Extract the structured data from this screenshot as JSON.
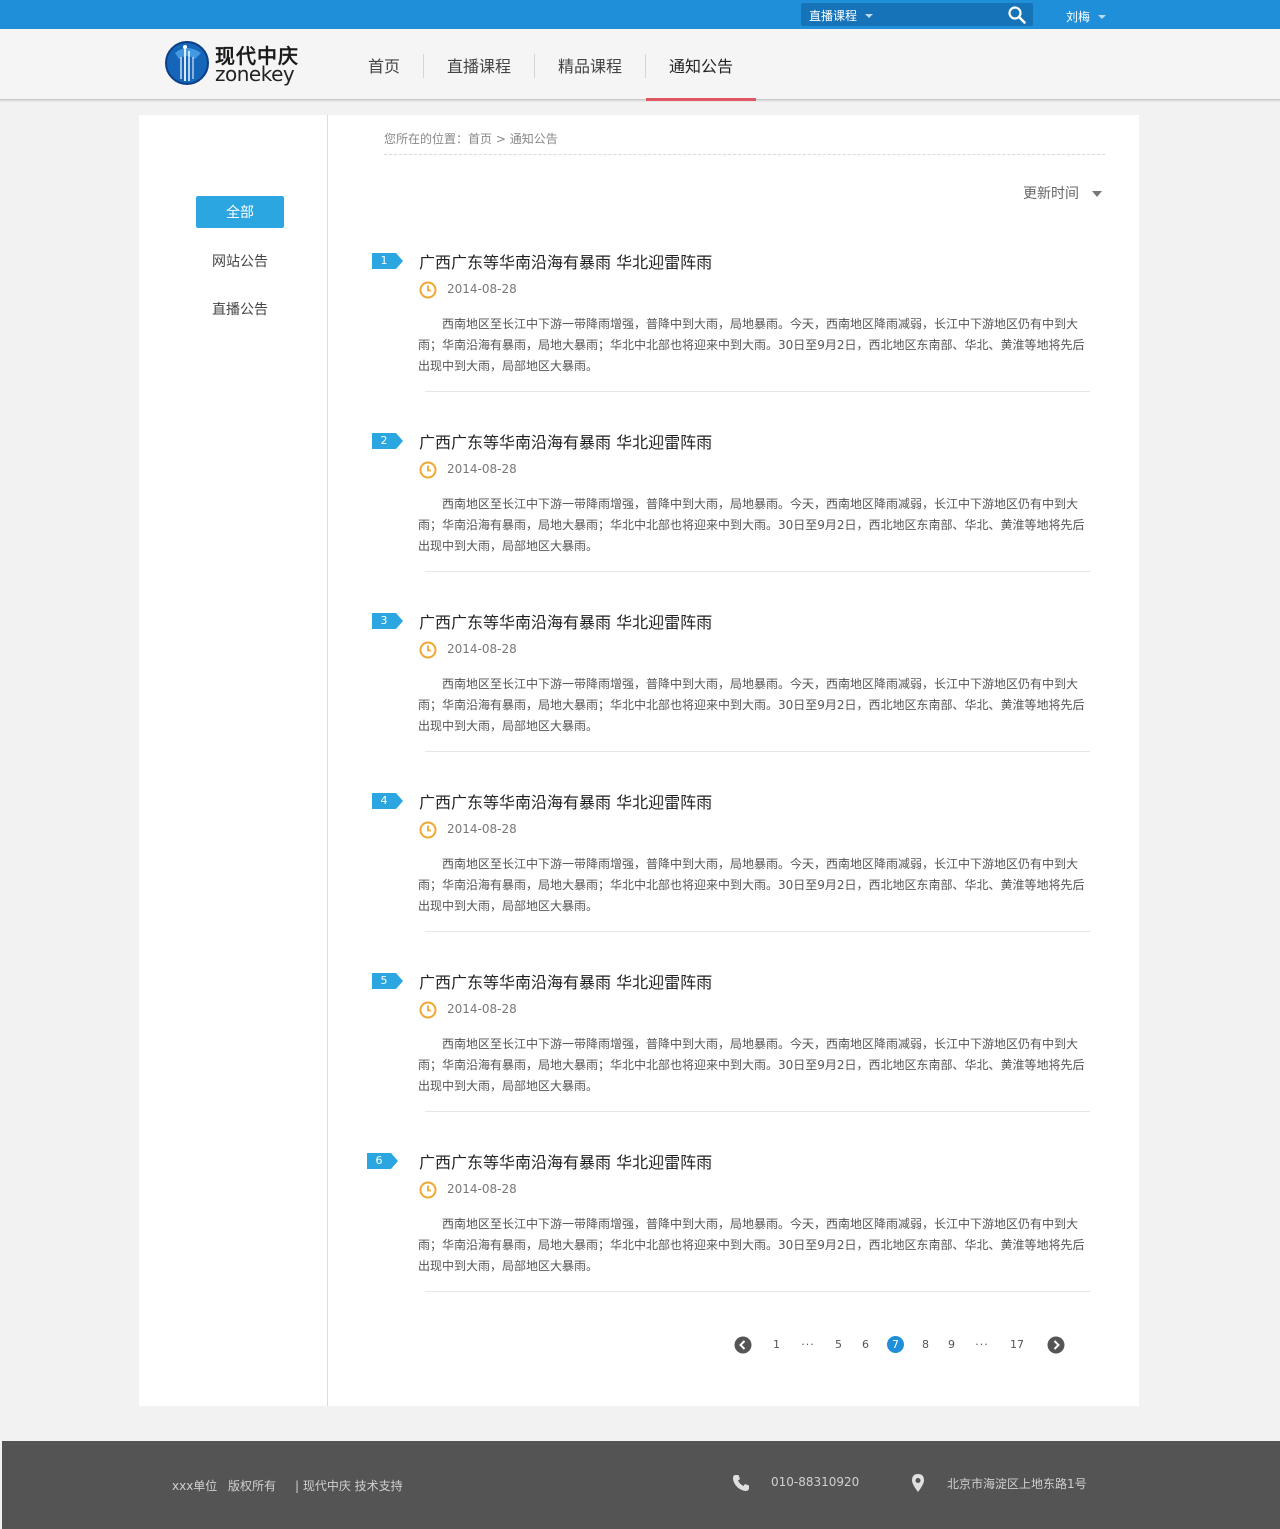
{
  "topbar": {
    "search_type": "直播课程",
    "search_placeholder": "",
    "user_name": "刘梅"
  },
  "logo": {
    "cn": "现代中庆",
    "en": "zonekey"
  },
  "nav": {
    "items": [
      {
        "label": "首页",
        "active": false
      },
      {
        "label": "直播课程",
        "active": false
      },
      {
        "label": "精品课程",
        "active": false
      },
      {
        "label": "通知公告",
        "active": true
      }
    ]
  },
  "sidebar": {
    "items": [
      {
        "label": "全部",
        "active": true
      },
      {
        "label": "网站公告",
        "active": false
      },
      {
        "label": "直播公告",
        "active": false
      }
    ]
  },
  "breadcrumb": {
    "prefix": "您所在的位置：",
    "home": "首页",
    "sep": " > ",
    "current": "通知公告"
  },
  "sort": {
    "label": "更新时间"
  },
  "notices": [
    {
      "num": "1",
      "title": "广西广东等华南沿海有暴雨 华北迎雷阵雨",
      "date": "2014-08-28",
      "body": "西南地区至长江中下游一带降雨增强，普降中到大雨，局地暴雨。今天，西南地区降雨减弱，长江中下游地区仍有中到大雨；华南沿海有暴雨，局地大暴雨；华北中北部也将迎来中到大雨。30日至9月2日，西北地区东南部、华北、黄淮等地将先后出现中到大雨，局部地区大暴雨。"
    },
    {
      "num": "2",
      "title": "广西广东等华南沿海有暴雨 华北迎雷阵雨",
      "date": "2014-08-28",
      "body": "西南地区至长江中下游一带降雨增强，普降中到大雨，局地暴雨。今天，西南地区降雨减弱，长江中下游地区仍有中到大雨；华南沿海有暴雨，局地大暴雨；华北中北部也将迎来中到大雨。30日至9月2日，西北地区东南部、华北、黄淮等地将先后出现中到大雨，局部地区大暴雨。"
    },
    {
      "num": "3",
      "title": "广西广东等华南沿海有暴雨 华北迎雷阵雨",
      "date": "2014-08-28",
      "body": "西南地区至长江中下游一带降雨增强，普降中到大雨，局地暴雨。今天，西南地区降雨减弱，长江中下游地区仍有中到大雨；华南沿海有暴雨，局地大暴雨；华北中北部也将迎来中到大雨。30日至9月2日，西北地区东南部、华北、黄淮等地将先后出现中到大雨，局部地区大暴雨。"
    },
    {
      "num": "4",
      "title": "广西广东等华南沿海有暴雨 华北迎雷阵雨",
      "date": "2014-08-28",
      "body": "西南地区至长江中下游一带降雨增强，普降中到大雨，局地暴雨。今天，西南地区降雨减弱，长江中下游地区仍有中到大雨；华南沿海有暴雨，局地大暴雨；华北中北部也将迎来中到大雨。30日至9月2日，西北地区东南部、华北、黄淮等地将先后出现中到大雨，局部地区大暴雨。"
    },
    {
      "num": "5",
      "title": "广西广东等华南沿海有暴雨 华北迎雷阵雨",
      "date": "2014-08-28",
      "body": "西南地区至长江中下游一带降雨增强，普降中到大雨，局地暴雨。今天，西南地区降雨减弱，长江中下游地区仍有中到大雨；华南沿海有暴雨，局地大暴雨；华北中北部也将迎来中到大雨。30日至9月2日，西北地区东南部、华北、黄淮等地将先后出现中到大雨，局部地区大暴雨。"
    },
    {
      "num": "6",
      "title": "广西广东等华南沿海有暴雨 华北迎雷阵雨",
      "date": "2014-08-28",
      "body": "西南地区至长江中下游一带降雨增强，普降中到大雨，局地暴雨。今天，西南地区降雨减弱，长江中下游地区仍有中到大雨；华南沿海有暴雨，局地大暴雨；华北中北部也将迎来中到大雨。30日至9月2日，西北地区东南部、华北、黄淮等地将先后出现中到大雨，局部地区大暴雨。"
    }
  ],
  "pagination": {
    "pages": [
      "1",
      "···",
      "5",
      "6",
      "7",
      "8",
      "9",
      "···",
      "17"
    ],
    "current": "7"
  },
  "footer": {
    "unit": "xxx单位",
    "rights": "版权所有",
    "support": "|  现代中庆 技术支持",
    "phone": "010-88310920",
    "address": "北京市海淀区上地东路1号"
  },
  "colors": {
    "topbar": "#1e8fd8",
    "accent": "#2ba6e1",
    "nav_active_underline": "#e05763",
    "clock": "#f0a830",
    "footer": "#545454"
  },
  "icons": [
    "search-icon",
    "chevron-down-icon",
    "clock-icon",
    "chevron-left-icon",
    "chevron-right-icon",
    "phone-icon",
    "location-pin-icon"
  ]
}
